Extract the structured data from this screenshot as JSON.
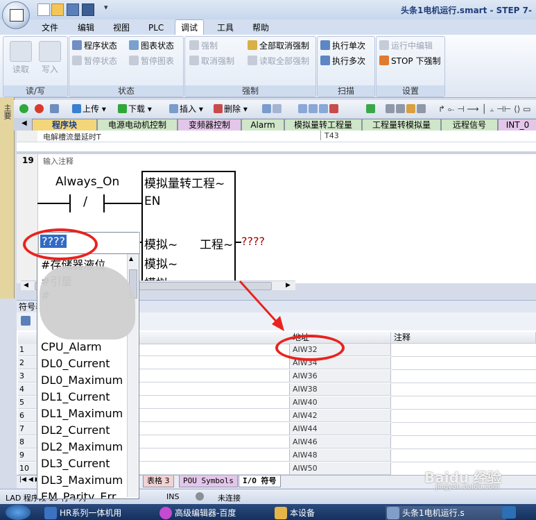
{
  "window": {
    "title": "头条1电机运行.smart - STEP 7-"
  },
  "menu": {
    "items": [
      "文件",
      "编辑",
      "视图",
      "PLC",
      "调试",
      "工具",
      "帮助"
    ],
    "active_index": 4
  },
  "ribbon": {
    "groups": [
      {
        "title": "读/写",
        "big_buttons": [
          "读取",
          "写入"
        ]
      },
      {
        "title": "状态",
        "buttons": [
          "程序状态",
          "暂停状态",
          "图表状态",
          "暂停图表"
        ]
      },
      {
        "title": "强制",
        "buttons": [
          "强制",
          "取消强制",
          "全部取消强制",
          "读取全部强制"
        ]
      },
      {
        "title": "扫描",
        "buttons": [
          "执行单次",
          "执行多次"
        ]
      },
      {
        "title": "设置",
        "buttons": [
          "运行中编辑",
          "STOP 下强制"
        ]
      }
    ]
  },
  "sidebar": {
    "tab_label": "主要"
  },
  "toolbar": {
    "upload": "上传",
    "download": "下载",
    "insert": "插入",
    "delete": "删除"
  },
  "pou_tabs": [
    "程序块",
    "电源电动机控制",
    "变频器控制",
    "Alarm",
    "模拟量转工程量",
    "工程量转模拟量",
    "远程信号",
    "INT_0"
  ],
  "editor": {
    "prev_network_comment": "电解槽流量延时T",
    "prev_network_address": "T43",
    "network_number": "19",
    "network_comment_placeholder": "输入注释",
    "contact_symbol": "Always_On",
    "contact_type": "/",
    "box_title": "模拟量转工程~",
    "box_en": "EN",
    "box_in1": "模拟~",
    "box_in2": "模拟~",
    "box_in3": "模拟~",
    "box_out": "工程~",
    "input_value": "????",
    "output_value": "????"
  },
  "symbol_table": {
    "title": "符号表",
    "columns": [
      "地址",
      "注释"
    ],
    "row_numbers": [
      "1",
      "2",
      "3",
      "4",
      "5",
      "6",
      "7",
      "8",
      "9",
      "10"
    ],
    "addresses": [
      "AIW32",
      "AIW34",
      "AIW36",
      "AIW38",
      "AIW40",
      "AIW42",
      "AIW44",
      "AIW46",
      "AIW48",
      "AIW50"
    ]
  },
  "dropdown": {
    "items": [
      "CPU_Alarm",
      "DL0_Current",
      "DL0_Maximum",
      "DL1_Current",
      "DL1_Maximum",
      "DL2_Current",
      "DL2_Maximum",
      "DL3_Current",
      "DL3_Maximum",
      "EM_Parity_Err"
    ],
    "partial_top_items": [
      "#存储器液位",
      "#引量",
      "#"
    ]
  },
  "bottom_tabs": [
    "表格 3",
    "POU Symbols",
    "I/O 符号"
  ],
  "status_bar": {
    "mode": "LAD 程序段 19 行 4 列",
    "insert_mode": "INS",
    "connection": "未连接"
  },
  "taskbar": {
    "items": [
      "HR系列一体机用",
      "高级编辑器-百度",
      "本设备",
      "头条1电机运行.s"
    ]
  },
  "watermark": {
    "text": "Baidu 经验",
    "sub": "jingyan.baidu.com"
  },
  "colors": {
    "accent": "#1f3d7a",
    "annotation_red": "#e8231f",
    "selected_blue": "#316ac5"
  }
}
